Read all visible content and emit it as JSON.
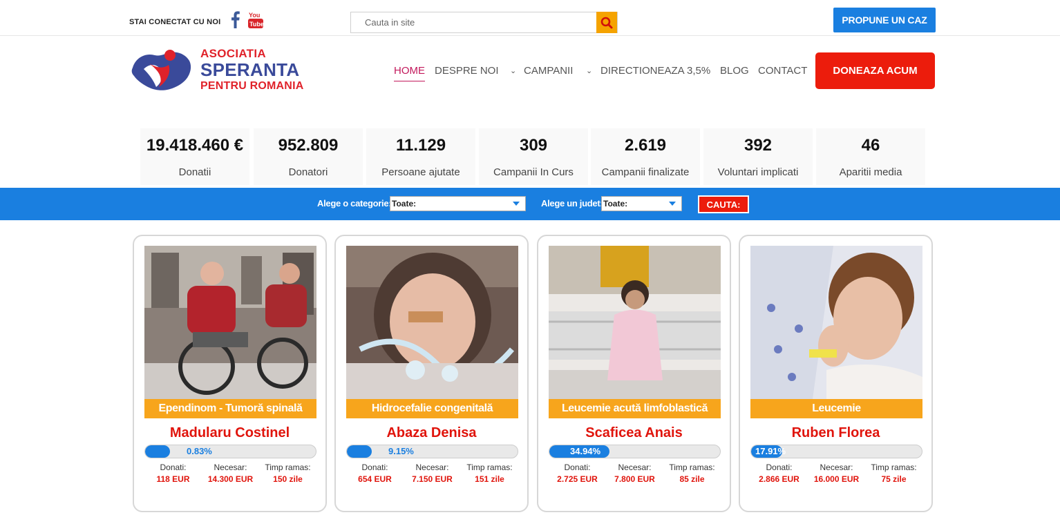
{
  "topbar": {
    "connect_text": "STAI CONECTAT CU NOI",
    "search_placeholder": "Cauta in site",
    "propose_label": "PROPUNE UN CAZ",
    "icons": [
      "facebook-icon",
      "youtube-icon",
      "search-icon"
    ]
  },
  "logo": {
    "line1": "ASOCIATIA",
    "line2": "SPERANTA",
    "line3": "PENTRU ROMANIA"
  },
  "nav": {
    "items": [
      {
        "label": "HOME",
        "active": true
      },
      {
        "label": "DESPRE NOI",
        "dropdown": true
      },
      {
        "label": "CAMPANII",
        "dropdown": true
      },
      {
        "label": "DIRECTIONEAZA 3,5%"
      },
      {
        "label": "BLOG"
      },
      {
        "label": "CONTACT"
      }
    ],
    "donate_label": "DONEAZA ACUM"
  },
  "stats": [
    {
      "value": "19.418.460 €",
      "label": "Donatii"
    },
    {
      "value": "952.809",
      "label": "Donatori"
    },
    {
      "value": "11.129",
      "label": "Persoane ajutate"
    },
    {
      "value": "309",
      "label": "Campanii In Curs"
    },
    {
      "value": "2.619",
      "label": "Campanii finalizate"
    },
    {
      "value": "392",
      "label": "Voluntari implicati"
    },
    {
      "value": "46",
      "label": "Aparitii media"
    }
  ],
  "filter": {
    "category_label": "Alege o categorie:",
    "category_value": "Toate:",
    "county_label": "Alege un judet:",
    "county_value": "Toate:",
    "search_label": "CAUTA:"
  },
  "campaigns": [
    {
      "category": "Ependinom - Tumoră spinală",
      "name": "Madularu Costinel",
      "progress": 0.83,
      "progress_text": "0.83%",
      "donated_label": "Donati:",
      "donated": "118 EUR",
      "needed_label": "Necesar:",
      "needed": "14.300 EUR",
      "time_label": "Timp ramas:",
      "time": "150 zile"
    },
    {
      "category": "Hidrocefalie congenitală",
      "name": "Abaza Denisa",
      "progress": 9.15,
      "progress_text": "9.15%",
      "donated_label": "Donati:",
      "donated": "654 EUR",
      "needed_label": "Necesar:",
      "needed": "7.150 EUR",
      "time_label": "Timp ramas:",
      "time": "151 zile"
    },
    {
      "category": "Leucemie acută limfoblastică",
      "name": "Scaficea Anais",
      "progress": 34.94,
      "progress_text": "34.94%",
      "donated_label": "Donati:",
      "donated": "2.725 EUR",
      "needed_label": "Necesar:",
      "needed": "7.800 EUR",
      "time_label": "Timp ramas:",
      "time": "85 zile"
    },
    {
      "category": "Leucemie",
      "name": "Ruben Florea",
      "progress": 17.91,
      "progress_text": "17.91%",
      "donated_label": "Donati:",
      "donated": "2.866 EUR",
      "needed_label": "Necesar:",
      "needed": "16.000 EUR",
      "time_label": "Timp ramas:",
      "time": "75 zile"
    }
  ],
  "colors": {
    "brand_blue": "#1a7fe0",
    "brand_red": "#ec1c0c",
    "category_orange": "#f7a51c",
    "nav_active": "#c2185b"
  }
}
